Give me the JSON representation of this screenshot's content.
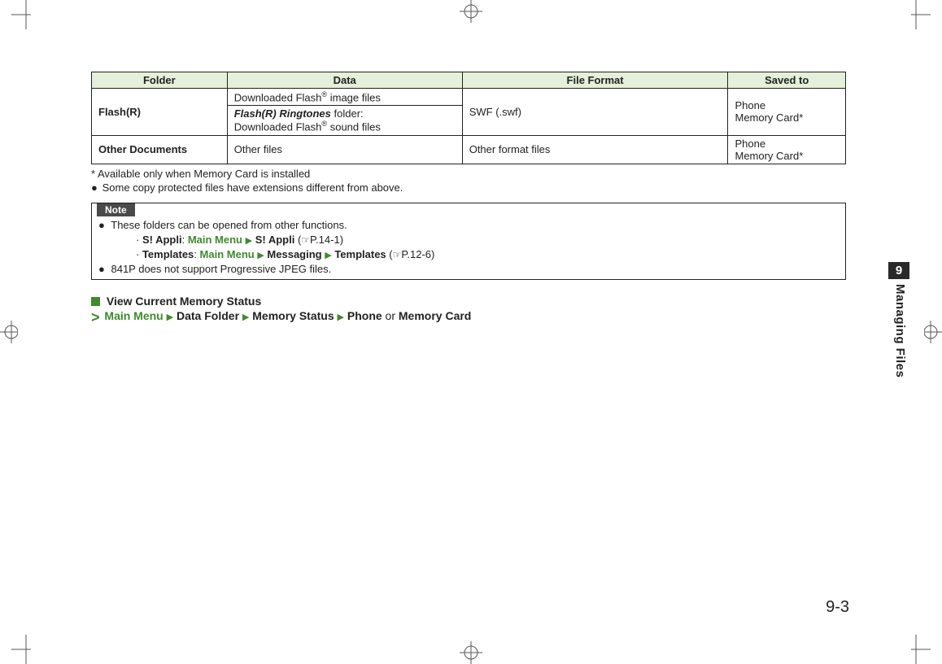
{
  "table": {
    "headers": {
      "folder": "Folder",
      "data": "Data",
      "format": "File Format",
      "saved": "Saved to"
    },
    "rows": [
      {
        "folder": "Flash(R)",
        "data1_pre": "Downloaded Flash",
        "data1_sup": "®",
        "data1_post": " image files",
        "data2_em": "Flash(R) Ringtones",
        "data2_mid": " folder:",
        "data2_pre": "Downloaded Flash",
        "data2_sup": "®",
        "data2_post": " sound files",
        "format": "SWF (.swf)",
        "saved1": "Phone",
        "saved2": "Memory Card*"
      },
      {
        "folder": "Other Documents",
        "data": "Other files",
        "format": "Other format files",
        "saved1": "Phone",
        "saved2": "Memory Card*"
      }
    ]
  },
  "footnotes": {
    "asterisk": "* Available only when Memory Card is installed",
    "bullet1": "Some copy protected files have extensions different from above."
  },
  "note": {
    "label": "Note",
    "line1": "These folders can be opened from other functions.",
    "sub1_a": "S! Appli",
    "sub1_main": "Main Menu",
    "sub1_b": "S! Appli",
    "sub1_ref": "P.14-1",
    "sub2_a": "Templates",
    "sub2_main": "Main Menu",
    "sub2_b": "Messaging",
    "sub2_c": "Templates",
    "sub2_ref": "P.12-6",
    "line2": "841P does not support Progressive JPEG files."
  },
  "section": {
    "title": "View Current Memory Status",
    "nav_main": "Main Menu",
    "nav_b": "Data Folder",
    "nav_c": "Memory Status",
    "nav_d": "Phone",
    "nav_or": " or ",
    "nav_e": "Memory Card"
  },
  "sidetab": {
    "num": "9",
    "label": "Managing Files"
  },
  "page_number": "9-3"
}
